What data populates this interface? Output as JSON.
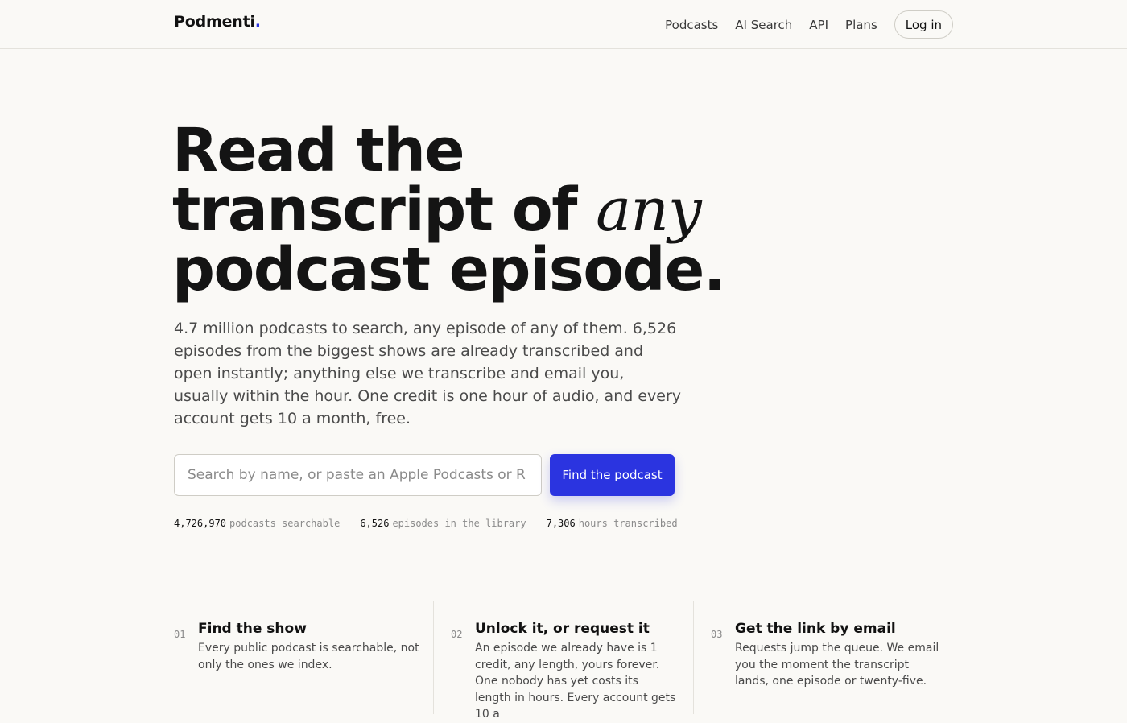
{
  "brand": {
    "name": "Podmenti",
    "dot": ".",
    "accent": "#2b34e0"
  },
  "nav": {
    "items": [
      "Podcasts",
      "AI Search",
      "API",
      "Plans"
    ],
    "login_label": "Log in"
  },
  "hero": {
    "line1": "Read the",
    "line2": "transcript of",
    "emphasis": "any",
    "line3": "podcast episode.",
    "subtitle": "4.7 million podcasts to search, any episode of any of them. 6,526 episodes from the biggest shows are already transcribed and open instantly; anything else we transcribe and email you, usually within the hour. One credit is one hour of audio, and every account gets 10 a month, free."
  },
  "search": {
    "placeholder": "Search by name, or paste an Apple Podcasts or R",
    "button_label": "Find the podcast"
  },
  "stats": [
    {
      "value": "4,726,970",
      "label": "podcasts searchable"
    },
    {
      "value": "6,526",
      "label": "episodes in the library"
    },
    {
      "value": "7,306",
      "label": "hours transcribed"
    }
  ],
  "steps": [
    {
      "number": "01",
      "title": "Find the show",
      "text": "Every public podcast is searchable, not only the ones we index."
    },
    {
      "number": "02",
      "title": "Unlock it, or request it",
      "text": "An episode we already have is 1 credit, any length, yours forever. One nobody has yet costs its length in hours. Every account gets 10 a"
    },
    {
      "number": "03",
      "title": "Get the link by email",
      "text": "Requests jump the queue. We email you the moment the transcript lands, one episode or twenty-five."
    }
  ]
}
